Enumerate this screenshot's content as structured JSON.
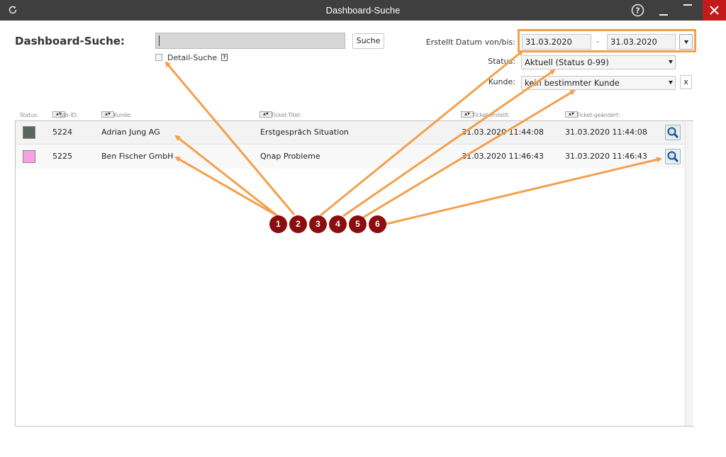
{
  "window": {
    "title": "Dashboard-Suche"
  },
  "page": {
    "title": "Dashboard-Suche:",
    "search_value": "",
    "search_button": "Suche",
    "detail_label": "Detail-Suche",
    "detail_help": "?"
  },
  "filters": {
    "date_label": "Erstellt Datum von/bis:",
    "date_from": "31.03.2020",
    "date_sep": "-",
    "date_to": "31.03.2020",
    "status_label": "Status:",
    "status_value": "Aktuell (Status 0-99)",
    "kunde_label": "Kunde:",
    "kunde_value": "kein bestimmter Kunde",
    "clear_label": "x"
  },
  "columns": [
    "Status:",
    "Job-ID:",
    "Kunde:",
    "Ticket-Titel:",
    "Ticket erstellt:",
    "Ticket-geändert:"
  ],
  "rows": [
    {
      "color": "#56665a",
      "id": "5224",
      "kunde": "Adrian Jung AG",
      "titel": "Erstgespräch Situation",
      "erstellt": "31.03.2020 11:44:08",
      "geaendert": "31.03.2020 11:44:08"
    },
    {
      "color": "#f7a0e2",
      "id": "5225",
      "kunde": "Ben Fischer GmbH",
      "titel": "Qnap Probleme",
      "erstellt": "31.03.2020 11:46:43",
      "geaendert": "31.03.2020 11:46:43"
    }
  ],
  "annotations": [
    "1",
    "2",
    "3",
    "4",
    "5",
    "6"
  ],
  "colors": {
    "annotation_line": "#f2a04c",
    "badge": "#8b0d0d",
    "titlebar": "#3f3f3f",
    "close": "#c41a1a"
  }
}
